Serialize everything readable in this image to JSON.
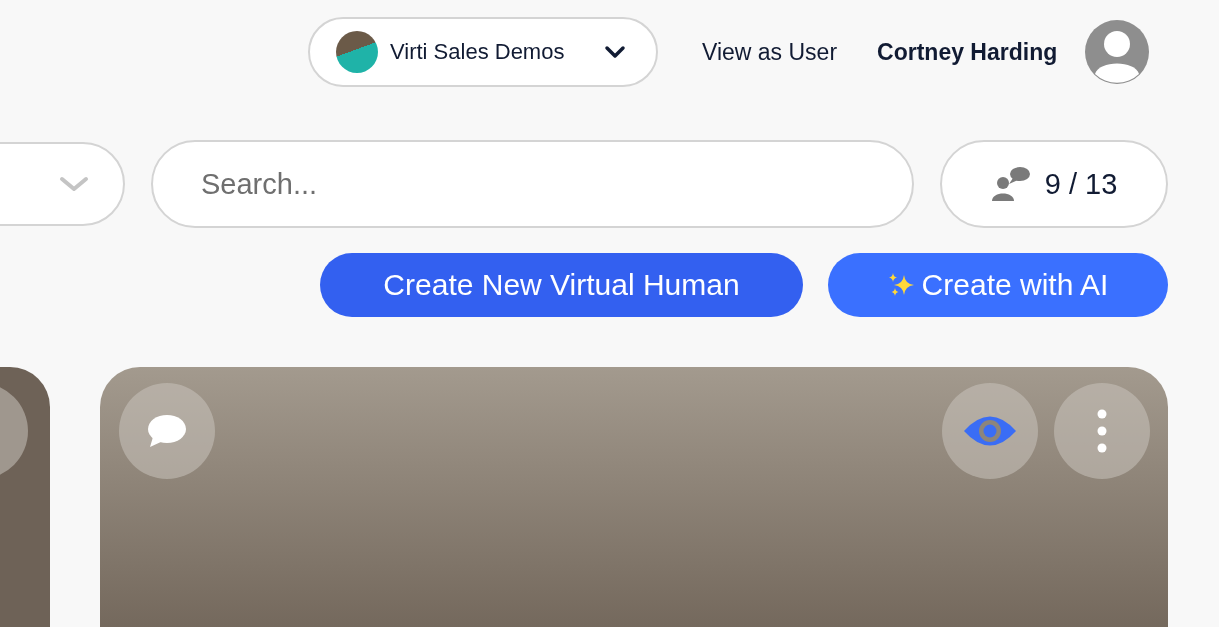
{
  "header": {
    "organization": {
      "name": "Virti Sales Demos"
    },
    "view_as_user": "View as User",
    "user_name": "Cortney Harding"
  },
  "filters": {
    "search": {
      "placeholder": "Search..."
    },
    "usage": "9 / 13"
  },
  "actions": [
    {
      "label": "Create New Virtual Human",
      "kind": "plain"
    },
    {
      "label": "Create with AI",
      "kind": "ai"
    }
  ]
}
